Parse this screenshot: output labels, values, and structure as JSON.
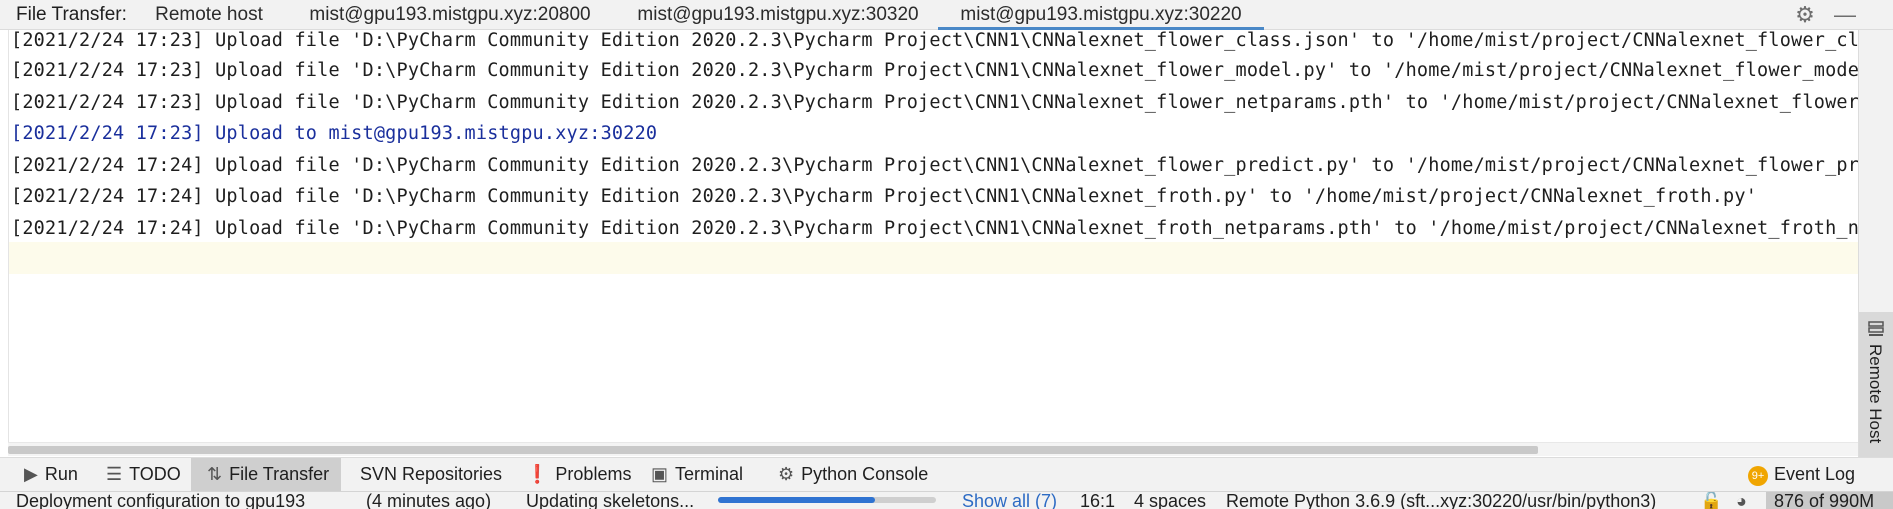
{
  "tabbar": {
    "label": "File Transfer:",
    "tabs": [
      {
        "label": "Remote host"
      },
      {
        "label": "mist@gpu193.mistgpu.xyz:20800"
      },
      {
        "label": "mist@gpu193.mistgpu.xyz:30320"
      },
      {
        "label": "mist@gpu193.mistgpu.xyz:30220",
        "active": true
      }
    ],
    "icons": [
      "gear-icon",
      "minimize-icon"
    ]
  },
  "log": {
    "lines": [
      {
        "text": "[2021/2/24 17:23] Upload file 'D:\\PyCharm Community Edition 2020.2.3\\Pycharm Project\\CNN1\\CNNalexnet_flower_class.json' to '/home/mist/project/CNNalexnet_flower_class.json'",
        "type": "normal"
      },
      {
        "text": "[2021/2/24 17:23] Upload file 'D:\\PyCharm Community Edition 2020.2.3\\Pycharm Project\\CNN1\\CNNalexnet_flower_model.py' to '/home/mist/project/CNNalexnet_flower_model.py'",
        "type": "normal"
      },
      {
        "text": "[2021/2/24 17:23] Upload file 'D:\\PyCharm Community Edition 2020.2.3\\Pycharm Project\\CNN1\\CNNalexnet_flower_netparams.pth' to '/home/mist/project/CNNalexnet_flower_netparams.pth'",
        "type": "normal"
      },
      {
        "text": "[2021/2/24 17:23] Upload to mist@gpu193.mistgpu.xyz:30220",
        "type": "info"
      },
      {
        "text": "[2021/2/24 17:24] Upload file 'D:\\PyCharm Community Edition 2020.2.3\\Pycharm Project\\CNN1\\CNNalexnet_flower_predict.py' to '/home/mist/project/CNNalexnet_flower_predict.py'",
        "type": "normal"
      },
      {
        "text": "[2021/2/24 17:24] Upload file 'D:\\PyCharm Community Edition 2020.2.3\\Pycharm Project\\CNN1\\CNNalexnet_froth.py' to '/home/mist/project/CNNalexnet_froth.py'",
        "type": "normal"
      },
      {
        "text": "[2021/2/24 17:24] Upload file 'D:\\PyCharm Community Edition 2020.2.3\\Pycharm Project\\CNN1\\CNNalexnet_froth_netparams.pth' to '/home/mist/project/CNNalexnet_froth_netparams.pth'",
        "type": "normal"
      }
    ]
  },
  "rightbar": {
    "label": "Remote Host",
    "icon": "remote-host-icon"
  },
  "toolwindows": [
    {
      "label": "Run",
      "icon": "run-icon",
      "glyph": "▶"
    },
    {
      "label": "TODO",
      "icon": "todo-icon",
      "glyph": "☰"
    },
    {
      "label": "File Transfer",
      "icon": "file-transfer-icon",
      "glyph": "⇅",
      "active": true
    },
    {
      "label": "SVN Repositories",
      "icon": "",
      "glyph": ""
    },
    {
      "label": "Problems",
      "icon": "problems-icon",
      "glyph": "❗"
    },
    {
      "label": "Terminal",
      "icon": "terminal-icon",
      "glyph": "▣"
    },
    {
      "label": "Python Console",
      "icon": "python-console-icon",
      "glyph": "⚙"
    }
  ],
  "event_log": {
    "label": "Event Log",
    "badge": "9+"
  },
  "status": {
    "message": "Deployment configuration to gpu193",
    "time_ago": "(4 minutes ago)",
    "task": "Updating skeletons...",
    "progress": 0.72,
    "show_all": "Show all (7)",
    "position": "16:1",
    "indent": "4 spaces",
    "interpreter": "Remote Python 3.6.9 (sft...xyz:30220/usr/bin/python3)",
    "memory": "876 of 990M"
  },
  "colors": {
    "accent": "#4a88c7",
    "info_text": "#1a2f9c",
    "progress": "#2f73d1",
    "badge": "#f0a500"
  }
}
